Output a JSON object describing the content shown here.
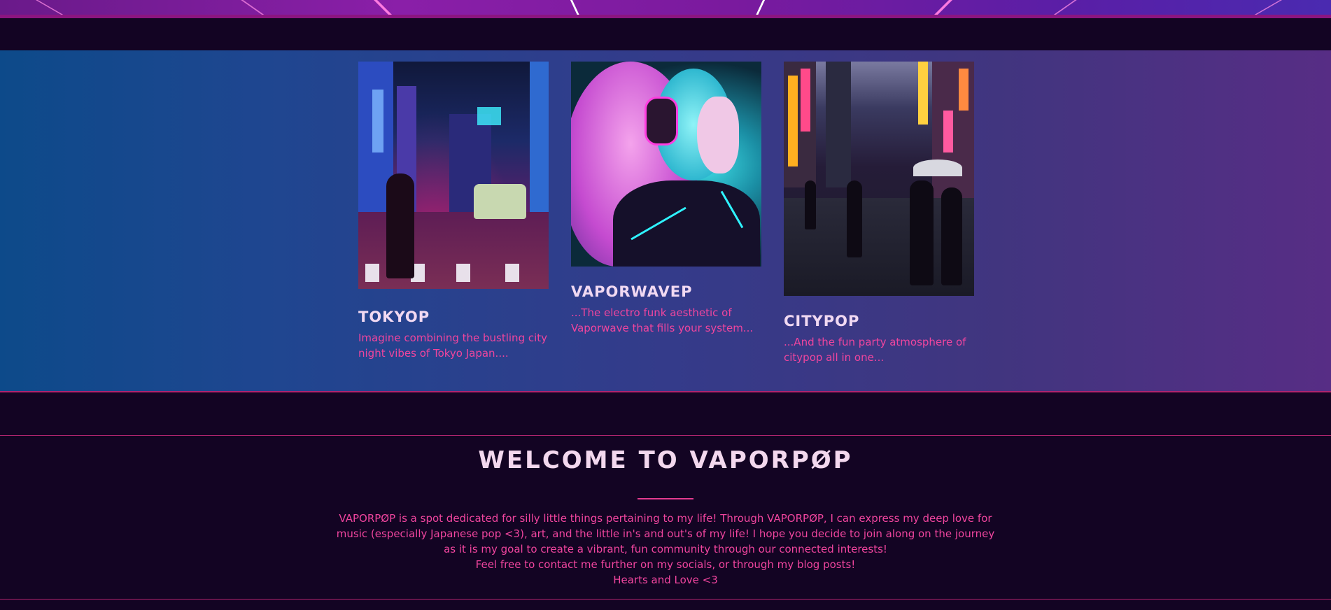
{
  "cards": [
    {
      "title": "TOKYOP",
      "text": "Imagine combining the bustling city night vibes of Tokyo Japan....",
      "image": "tokyo-night-street-photo"
    },
    {
      "title": "VAPORWAVEP",
      "text": "...The electro funk aesthetic of Vaporwave that fills your system...",
      "image": "vaporwave-girl-headphones-illustration"
    },
    {
      "title": "CITYPOP",
      "text": "...And the fun party atmosphere of citypop all in one...",
      "image": "neon-city-street-photo"
    }
  ],
  "welcome": {
    "title": "WELCOME TO VAPORPØP",
    "paragraph": "VAPORPØP is a spot dedicated for silly little things pertaining to my life! Through VAPORPØP, I can express my deep love for music (especially Japanese pop <3), art, and the little in's and out's of my life! I hope you decide to join along on the journey as it is my goal to create a vibrant, fun community through our connected interests!",
    "line2": "Feel free to contact me further on my socials, or through my blog posts!",
    "line3": "Hearts and Love <3"
  },
  "colors": {
    "background": "#130423",
    "accent_pink": "#f0459e",
    "title_light": "#f3d8ee",
    "divider": "#b0246e"
  }
}
